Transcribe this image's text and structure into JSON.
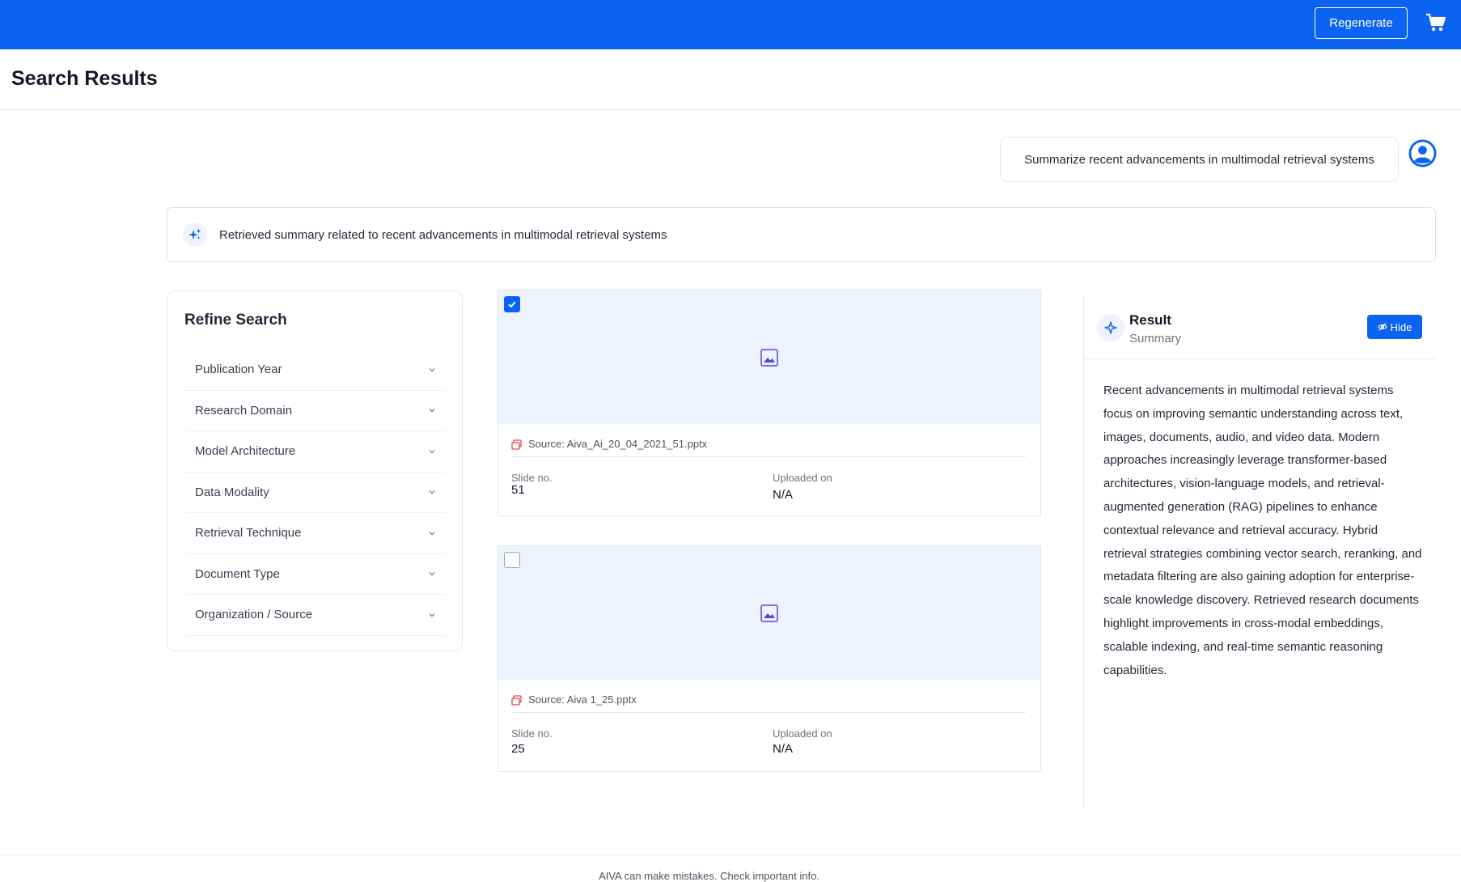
{
  "topbar": {
    "regenerate_label": "Regenerate",
    "cart_icon": "cart-icon",
    "background_color": "#0b63f1"
  },
  "page": {
    "title": "Search Results"
  },
  "query": {
    "text": "Summarize recent advancements in multimodal retrieval systems",
    "avatar_icon": "user-circle-icon"
  },
  "banner": {
    "icon": "sparkle-icon",
    "text": "Retrieved summary related to recent advancements in multimodal retrieval systems"
  },
  "refine": {
    "title": "Refine Search",
    "filters": [
      {
        "label": "Publication Year"
      },
      {
        "label": "Research Domain"
      },
      {
        "label": "Model Architecture"
      },
      {
        "label": "Data Modality"
      },
      {
        "label": "Retrieval Technique"
      },
      {
        "label": "Document Type"
      },
      {
        "label": "Organization / Source"
      }
    ]
  },
  "results": [
    {
      "checked": true,
      "source": "Source: Aiva_Ai_20_04_2021_51.pptx",
      "slide_label": "Slide no.",
      "slide_value": "51",
      "uploaded_label": "Uploaded on",
      "uploaded_value": "N/A"
    },
    {
      "checked": false,
      "source": "Source: Aiva 1_25.pptx",
      "slide_label": "Slide no.",
      "slide_value": "25",
      "uploaded_label": "Uploaded on",
      "uploaded_value": "N/A"
    }
  ],
  "result_panel": {
    "title": "Result",
    "subtitle": "Summary",
    "hide_label": "Hide",
    "body": "Recent advancements in multimodal retrieval systems focus on improving semantic understanding across text, images, documents, audio, and video data. Modern approaches increasingly leverage transformer-based architectures, vision-language models, and retrieval-augmented generation (RAG) pipelines to enhance contextual relevance and retrieval accuracy. Hybrid retrieval strategies combining vector search, reranking, and metadata filtering are also gaining adoption for enterprise-scale knowledge discovery. Retrieved research documents highlight improvements in cross-modal embeddings, scalable indexing, and real-time semantic reasoning capabilities."
  },
  "footer": {
    "text": "AIVA can make mistakes. Check important info."
  }
}
